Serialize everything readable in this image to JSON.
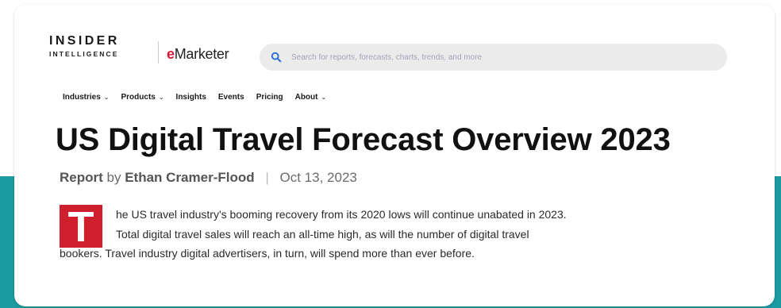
{
  "logo": {
    "insider_line1": "INSIDER",
    "insider_line2": "INTELLIGENCE",
    "emarketer_e": "e",
    "emarketer_rest": "Marketer"
  },
  "search": {
    "placeholder": "Search for reports, forecasts, charts, trends, and more",
    "icon": "search-icon"
  },
  "nav": {
    "items": [
      {
        "label": "Industries",
        "has_dropdown": true
      },
      {
        "label": "Products",
        "has_dropdown": true
      },
      {
        "label": "Insights",
        "has_dropdown": false
      },
      {
        "label": "Events",
        "has_dropdown": false
      },
      {
        "label": "Pricing",
        "has_dropdown": false
      },
      {
        "label": "About",
        "has_dropdown": true
      }
    ],
    "chevron": "⌄"
  },
  "article": {
    "title": "US Digital Travel Forecast Overview 2023",
    "type": "Report",
    "by": "by",
    "author": "Ethan Cramer-Flood",
    "separator": "|",
    "date": "Oct 13, 2023",
    "dropcap": "T",
    "line1": "he US travel industry's booming recovery from its 2020 lows will continue unabated in 2023.",
    "line2": "Total digital travel sales will reach an all-time high, as will the number of digital travel",
    "line3": "bookers. Travel industry digital advertisers, in turn, will spend more than ever before."
  },
  "colors": {
    "teal_background": "#1b9aa0",
    "brand_red": "#d7193a",
    "dropcap_red": "#cf1f2c"
  }
}
